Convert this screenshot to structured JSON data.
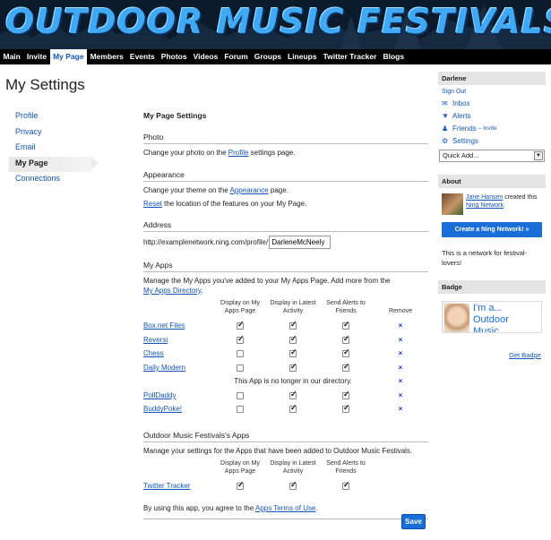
{
  "banner": {
    "title": "OUTDOOR MUSIC FESTIVALS"
  },
  "nav": [
    "Main",
    "Invite",
    "My Page",
    "Members",
    "Events",
    "Photos",
    "Videos",
    "Forum",
    "Groups",
    "Lineups",
    "Twitter Tracker",
    "Blogs"
  ],
  "page_title": "My Settings",
  "settings_nav": [
    "Profile",
    "Privacy",
    "Email",
    "My Page",
    "Connections"
  ],
  "main": {
    "heading": "My Page Settings",
    "photo": {
      "header": "Photo",
      "pre": "Change your photo on the ",
      "link": "Profile",
      "post": " settings page."
    },
    "appearance": {
      "header": "Appearance",
      "line1_pre": "Change your theme on the ",
      "line1_link": "Appearance",
      "line1_post": " page.",
      "line2_link": "Reset",
      "line2_post": " the location of the features on your My Page."
    },
    "address": {
      "header": "Address",
      "prefix": "http://examplenetwork.ning.com/profile/",
      "value": "DarleneMcNeely"
    },
    "my_apps": {
      "header": "My Apps",
      "desc": "Manage the My Apps you've added to your My Apps Page. Add more from the",
      "directory_link": "My Apps Directory",
      "directory_post": ".",
      "col_display_line1": "Display on My",
      "col_display_line2": "Apps Page",
      "col_latest_line1": "Display in Latest",
      "col_latest_line2": "Activity",
      "col_alerts_line1": "Send Alerts to",
      "col_alerts_line2": "Friends",
      "col_remove": "Remove",
      "missing_notice": "This App is no longer in our directory.",
      "remove_symbol": "×"
    },
    "network_apps": {
      "header": "Outdoor Music Festivals's Apps",
      "desc": "Manage your settings for the Apps that have been added to Outdoor Music Festivals.",
      "app_name": "Twitter Tracker"
    },
    "terms": {
      "pre": "By using this app, you agree to the ",
      "link": "Apps Terms of Use",
      "post": "."
    },
    "save": "Save"
  },
  "apps_rows": [
    {
      "name": "Box.net Files",
      "display": true,
      "latest": true,
      "alerts": true
    },
    {
      "name": "Reversi",
      "display": true,
      "latest": true,
      "alerts": true
    },
    {
      "name": "Chess",
      "display": false,
      "latest": true,
      "alerts": true
    },
    {
      "name": "Daily Modern",
      "display": false,
      "latest": true,
      "alerts": true
    },
    {
      "name": "PollDaddy",
      "display": false,
      "latest": true,
      "alerts": true
    },
    {
      "name": "BuddyPoke!",
      "display": false,
      "latest": true,
      "alerts": true
    }
  ],
  "network_app_row": {
    "display": true,
    "latest": true,
    "alerts": true
  },
  "sidebar": {
    "user_header": "Darlene",
    "sign_out": "Sign Out",
    "inbox": "Inbox",
    "alerts": "Alerts",
    "friends": "Friends",
    "friends_invite": "– Invite",
    "settings": "Settings",
    "quick_add": "Quick Add...",
    "about_header": "About",
    "about_user": "Jane Hansen",
    "about_mid": " created this ",
    "about_network": "Ning Network",
    "about_end": ".",
    "ning_button": "Create a Ning Network! »",
    "about_desc": "This is a network for festival-lovers!",
    "badge_header": "Badge",
    "badge_text_1": "I'm a...",
    "badge_text_2": "Outdoor",
    "badge_text_3": "Music",
    "get_badge": "Get Badge"
  },
  "icons": {
    "inbox": "envelope-icon",
    "alerts": "alert-icon",
    "friends": "person-icon",
    "settings": "gear-icon"
  },
  "colors": {
    "link": "#1155bb",
    "button": "#1a6ed8",
    "banner_title": "#3fa9f5",
    "nav_bg": "#000000"
  }
}
